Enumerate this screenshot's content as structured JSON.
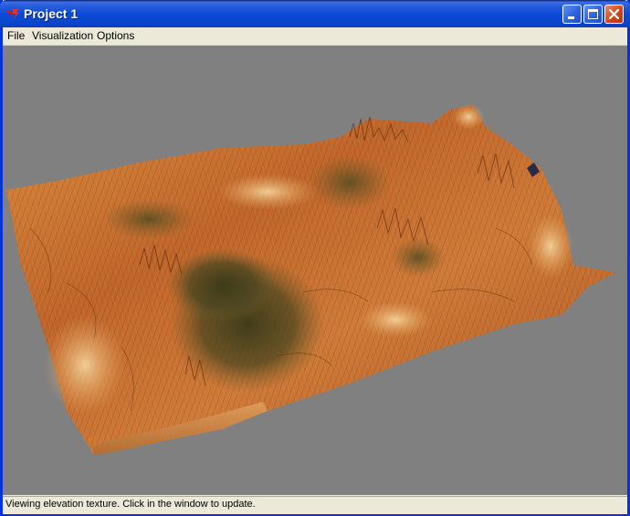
{
  "window": {
    "title": "Project 1",
    "controls": {
      "minimize": "minimize-icon",
      "maximize": "maximize-icon",
      "close": "close-icon"
    },
    "accent_color": "#0a47cf",
    "close_color": "#d8431c"
  },
  "menu": {
    "items": [
      {
        "label": "File"
      },
      {
        "label": "Visualization"
      },
      {
        "label": "Options"
      }
    ]
  },
  "viewport": {
    "background_color": "#808080",
    "content": "3d-terrain-render",
    "terrain_colors": [
      "#c8702a",
      "#e89a4a",
      "#8a4a1a",
      "#4a4a1e",
      "#f0c080"
    ]
  },
  "status": {
    "text": "Viewing elevation texture. Click in the window to update."
  }
}
